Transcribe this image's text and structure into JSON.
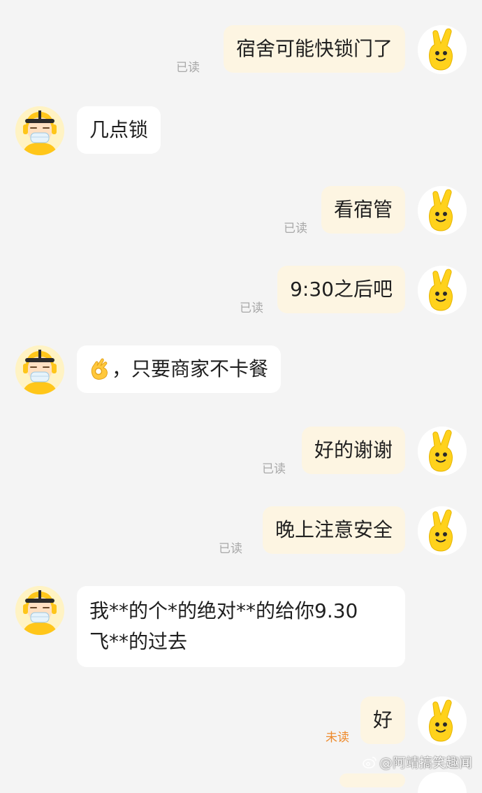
{
  "colors": {
    "background": "#f4f4f4",
    "my_bubble": "#fdf5e2",
    "rider_bubble": "#ffffff",
    "read_text": "#a8a8a8",
    "unread_text": "#ee8a2b",
    "mascot_yellow": "#ffd21c"
  },
  "icons": {
    "my_avatar": "yellow-hand-mascot-icon",
    "rider_avatar": "delivery-rider-with-mask-icon",
    "ok_emoji": "ok-hand-emoji-icon",
    "watermark": "weibo-logo-icon"
  },
  "messages": [
    {
      "sender": "me",
      "text": "宿舍可能快锁门了",
      "status": "已读"
    },
    {
      "sender": "rider",
      "text": "几点锁"
    },
    {
      "sender": "me",
      "text": "看宿管",
      "status": "已读"
    },
    {
      "sender": "me",
      "text": "9:30之后吧",
      "status": "已读"
    },
    {
      "sender": "rider",
      "text": "，只要商家不卡餐",
      "emoji": "ok-hand"
    },
    {
      "sender": "me",
      "text": "好的谢谢",
      "status": "已读"
    },
    {
      "sender": "me",
      "text": "晚上注意安全",
      "status": "已读"
    },
    {
      "sender": "rider",
      "text_line1": "我**的个*的绝对**的给你9.30",
      "text_line2": "飞**的过去"
    },
    {
      "sender": "me",
      "text": "好",
      "status": "未读"
    }
  ],
  "watermark": "@阿靖搞笑趣闻"
}
